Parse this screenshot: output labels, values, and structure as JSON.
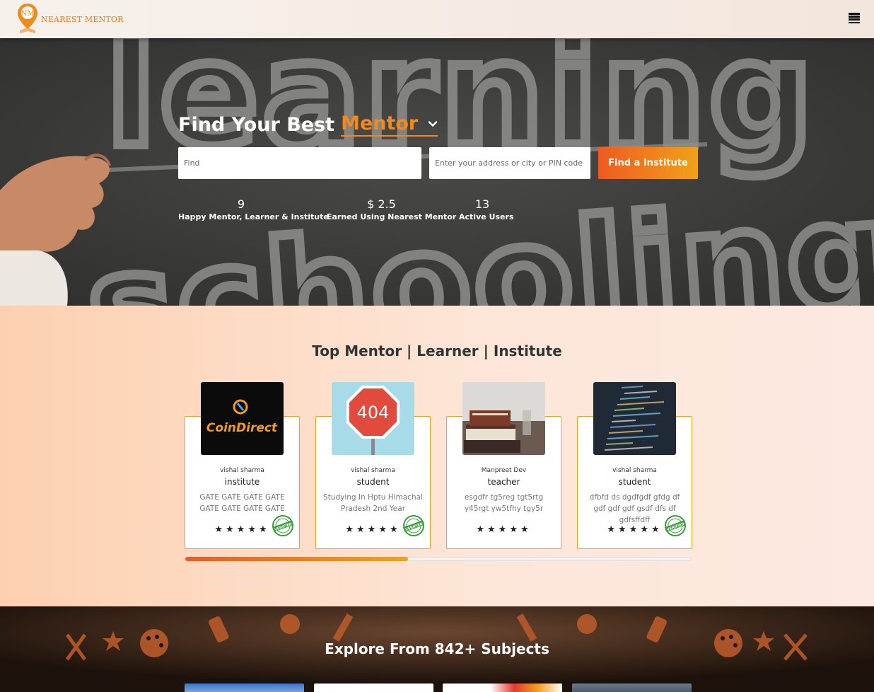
{
  "header": {
    "logo_text": "NEAREST MENTOR",
    "menu_icon": "hamburger-menu-icon"
  },
  "hero": {
    "title_prefix": "Find Your Best",
    "title_accent": "Mentor",
    "find_placeholder": "Find",
    "address_placeholder": "Enter your address or city or PIN code",
    "find_button": "Find a Institute",
    "chalk_text_1": "learning",
    "chalk_text_2": "schooling",
    "stats": [
      {
        "value": "9",
        "label": "Happy Mentor, Learner & Institute"
      },
      {
        "value": "$ 2.5",
        "label": "Earned Using Nearest Mentor"
      },
      {
        "value": "13",
        "label": "Active Users"
      }
    ]
  },
  "top": {
    "title": "Top Mentor | Learner | Institute",
    "cards": [
      {
        "name": "vishal sharma",
        "role": "institute",
        "desc": "GATE GATE GATE GATE GATE GATE GATE GATE",
        "verified": true,
        "image": "coindirect-logo",
        "image_text": "CoinDirect"
      },
      {
        "name": "vishal sharma",
        "role": "student",
        "desc": "Studying In Hptu Himachal Pradesh 2nd Year",
        "verified": true,
        "image": "404-stop-sign",
        "image_text": "404"
      },
      {
        "name": "Manpreet Dev",
        "role": "teacher",
        "desc": "esgdfr tg5reg tgt5rtg y45rgt yw5tfhy tgy5r",
        "verified": false,
        "image": "books-photo"
      },
      {
        "name": "vishal sharma",
        "role": "student",
        "desc": "dfbfd ds dgdfgdf gfdg df gdf gdf gdf gsdf dfs df gdfsffdff",
        "verified": true,
        "image": "code-screen-photo"
      }
    ],
    "stars": "★★★★★",
    "slider_progress": 0.44
  },
  "subjects": {
    "title": "Explore From 842+ Subjects"
  },
  "colors": {
    "accent": "#f18a1c",
    "gradient_start": "#ef5a1f",
    "gradient_end": "#f0a11b"
  }
}
